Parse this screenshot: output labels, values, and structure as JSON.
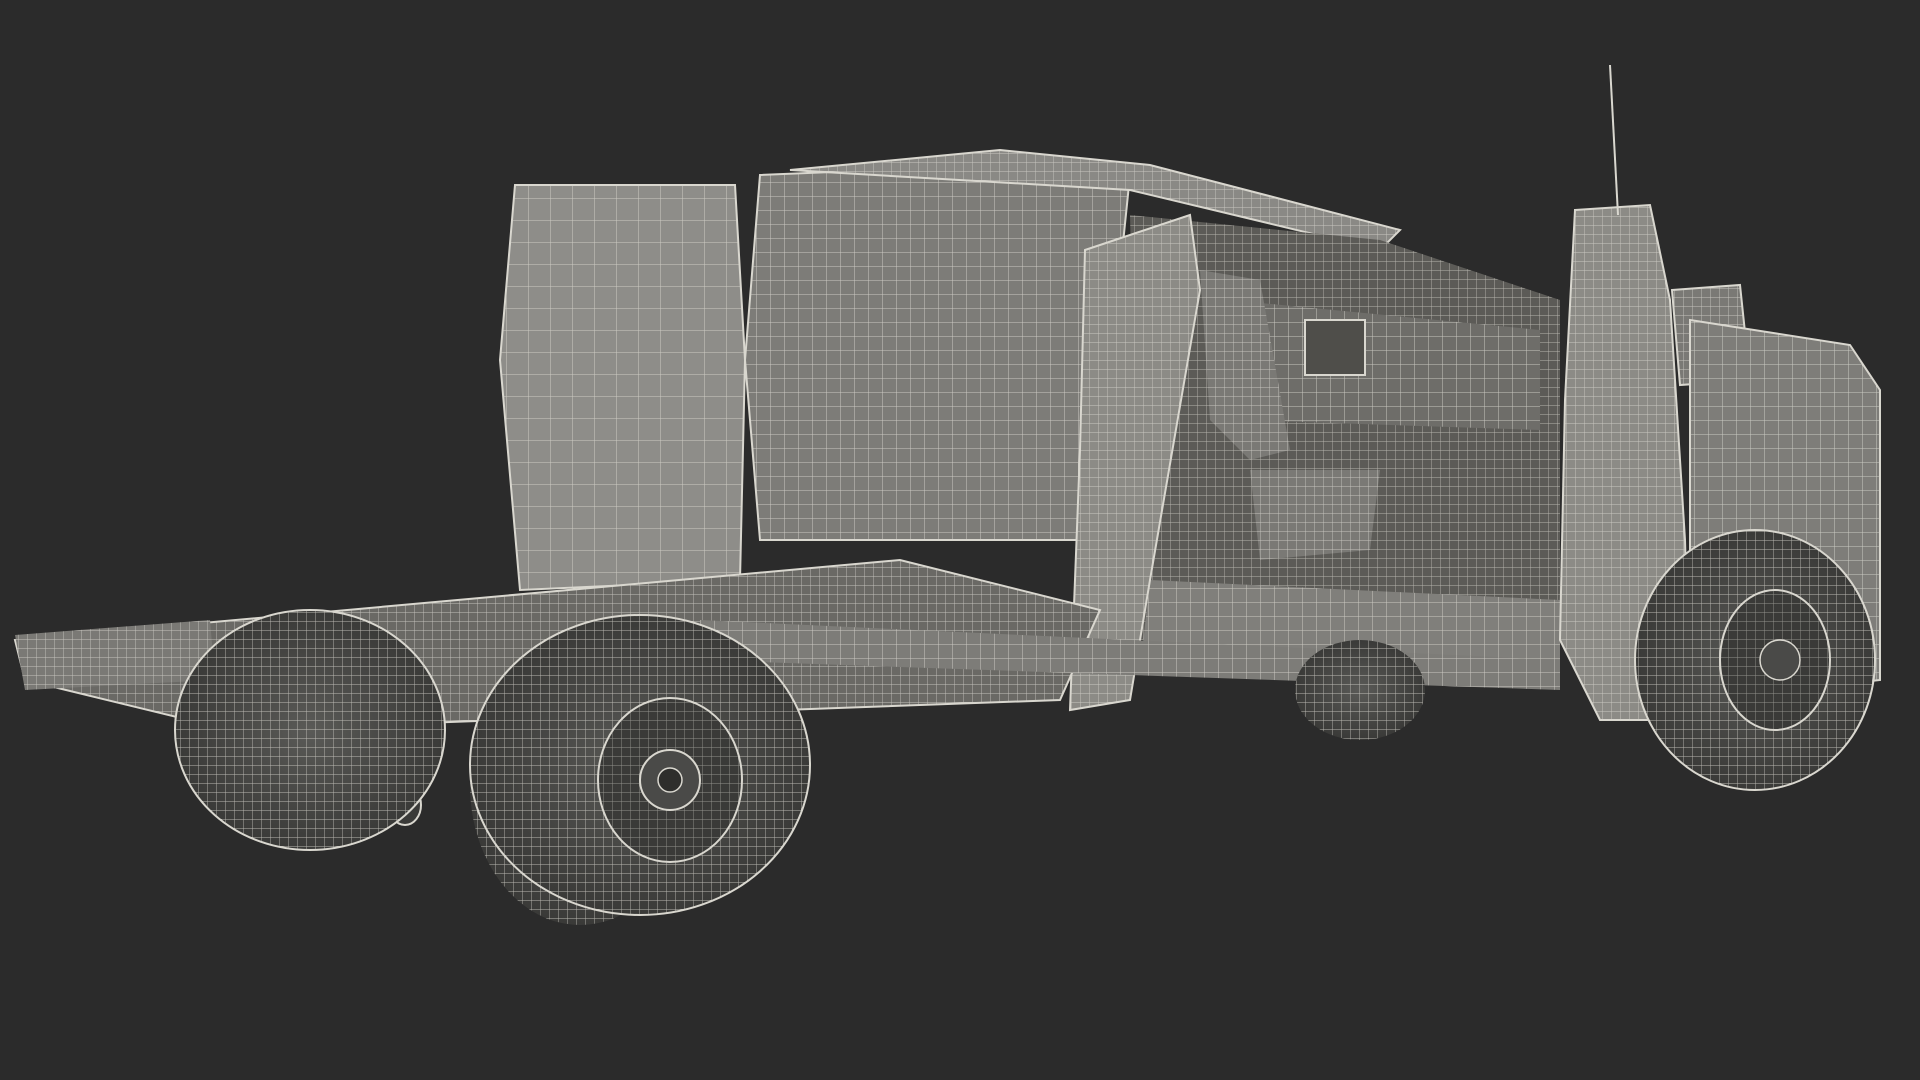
{
  "scene": {
    "subject": "wireframe-pickup-chassis-cab",
    "background_color": "#2b2b2b",
    "body_fill": "#8c8b86",
    "body_fill_dark": "#5f5e5a",
    "wire_color": "#d9d7cf",
    "tire_fill": "#4a4a48",
    "hub_fill": "#3a3a38"
  }
}
